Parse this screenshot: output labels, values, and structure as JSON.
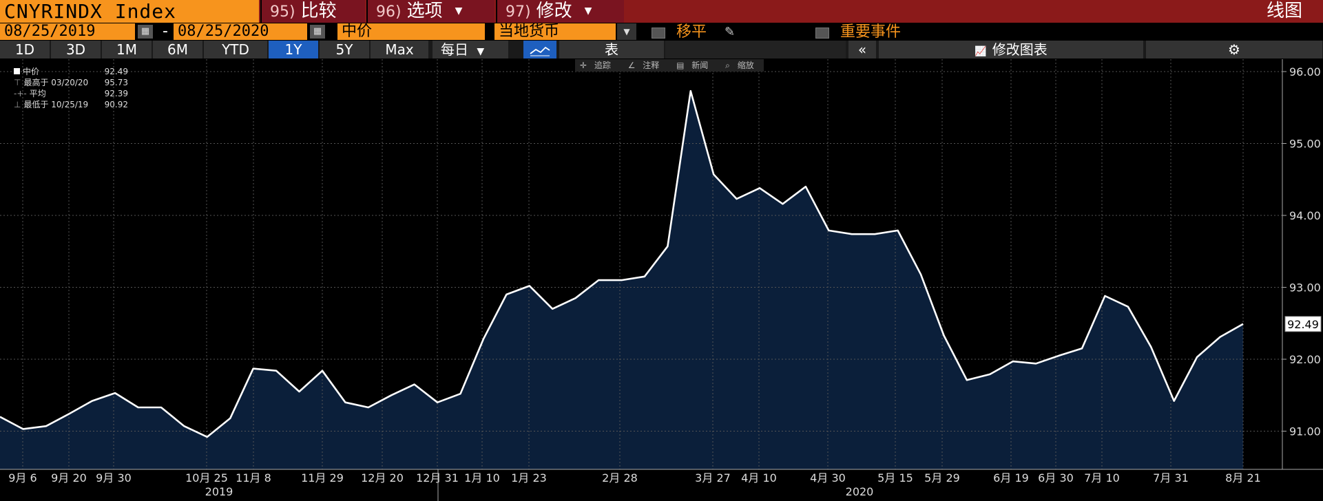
{
  "header": {
    "ticker": "CNYRINDX Index",
    "menu": [
      {
        "num": "95)",
        "label": "比较"
      },
      {
        "num": "96)",
        "label": "选项"
      },
      {
        "num": "97)",
        "label": "修改"
      }
    ],
    "view_title": "线图"
  },
  "controls": {
    "start_date": "08/25/2019",
    "separator": "-",
    "end_date": "08/25/2020",
    "price_field": "中价",
    "currency": "当地货币",
    "moving_avg_label": "移平",
    "events_label": "重要事件"
  },
  "tabs": {
    "ranges": [
      "1D",
      "3D",
      "1M",
      "6M",
      "YTD",
      "1Y",
      "5Y",
      "Max"
    ],
    "active_range": "1Y",
    "frequency": "每日",
    "table_label": "表",
    "collapse": "«",
    "edit_chart": "修改图表",
    "settings": "⚙"
  },
  "tools": [
    "追踪",
    "注释",
    "新闻",
    "缩放"
  ],
  "legend": [
    {
      "label": "中价",
      "value": "92.49"
    },
    {
      "label": "最高于 03/20/20",
      "value": "95.73"
    },
    {
      "label": "平均",
      "value": "92.39"
    },
    {
      "label": "最低于 10/25/19",
      "value": "90.92"
    }
  ],
  "colors": {
    "line": "#ffffff",
    "fill": "#0b1f3a",
    "grid": "#555555",
    "accent": "#f7941d",
    "header_bg": "#8b1a1a",
    "active_tab": "#1e5fbf"
  },
  "chart_data": {
    "type": "area",
    "title": "",
    "ylim": [
      90.5,
      96.3
    ],
    "yticks": [
      91,
      92,
      93,
      94,
      95,
      96
    ],
    "ytick_labels": [
      "91.00",
      "92.00",
      "93.00",
      "94.00",
      "95.00",
      "96.00"
    ],
    "last_value_label": "92.49",
    "x_labels": [
      "9月 6",
      "9月 20",
      "9月 30",
      "10月 25",
      "11月 8",
      "11月 29",
      "12月 20",
      "12月 31",
      "1月 10",
      "1月 23",
      "2月 28",
      "3月 27",
      "4月 10",
      "4月 30",
      "5月 15",
      "5月 29",
      "6月 19",
      "6月 30",
      "7月 10",
      "7月 31",
      "8月 21"
    ],
    "year_labels": [
      "2019",
      "2020"
    ],
    "grid": true,
    "series": [
      {
        "values": [
          91.2,
          91.03,
          91.07,
          91.24,
          91.42,
          91.53,
          91.33,
          91.33,
          91.07,
          90.92,
          91.18,
          91.87,
          91.84,
          91.55,
          91.84,
          91.4,
          91.33,
          91.5,
          91.65,
          91.4,
          91.52,
          92.28,
          92.9,
          93.02,
          92.7,
          92.85,
          93.1,
          93.1,
          93.15,
          93.57,
          95.73,
          94.57,
          94.23,
          94.38,
          94.16,
          94.4,
          93.79,
          93.74,
          93.74,
          93.79,
          93.18,
          92.33,
          91.71,
          91.79,
          91.97,
          91.94,
          92.05,
          92.15,
          92.88,
          92.73,
          92.17,
          91.42,
          92.03,
          92.31,
          92.49
        ]
      }
    ]
  }
}
